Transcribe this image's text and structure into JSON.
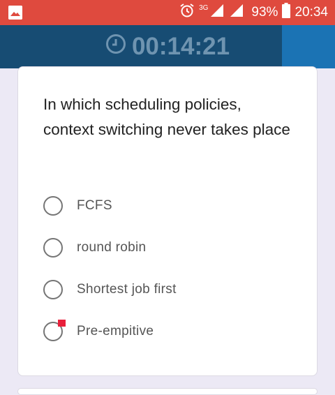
{
  "status_bar": {
    "network_type": "3G",
    "battery_percent": "93%",
    "time": "20:34",
    "icons": [
      "gallery-notification-icon",
      "alarm-icon",
      "signal-icon",
      "signal-icon",
      "battery-icon"
    ]
  },
  "timer": {
    "icon": "clock-icon",
    "value": "00:14:21"
  },
  "question": {
    "text": "In which scheduling policies, context switching never takes place",
    "options": [
      {
        "label": "FCFS",
        "selected": false
      },
      {
        "label": "round robin",
        "selected": false
      },
      {
        "label": "Shortest job first",
        "selected": false
      },
      {
        "label": "Pre-empitive",
        "selected": false
      }
    ]
  },
  "colors": {
    "status_bar": "#df4a3e",
    "timer_bar": "#174c73",
    "timer_bar_accent": "#1b73b4",
    "timer_text": "#6f94b0",
    "page_background": "#ece9f5",
    "radio_border": "#757575",
    "marker": "#e8203b"
  }
}
